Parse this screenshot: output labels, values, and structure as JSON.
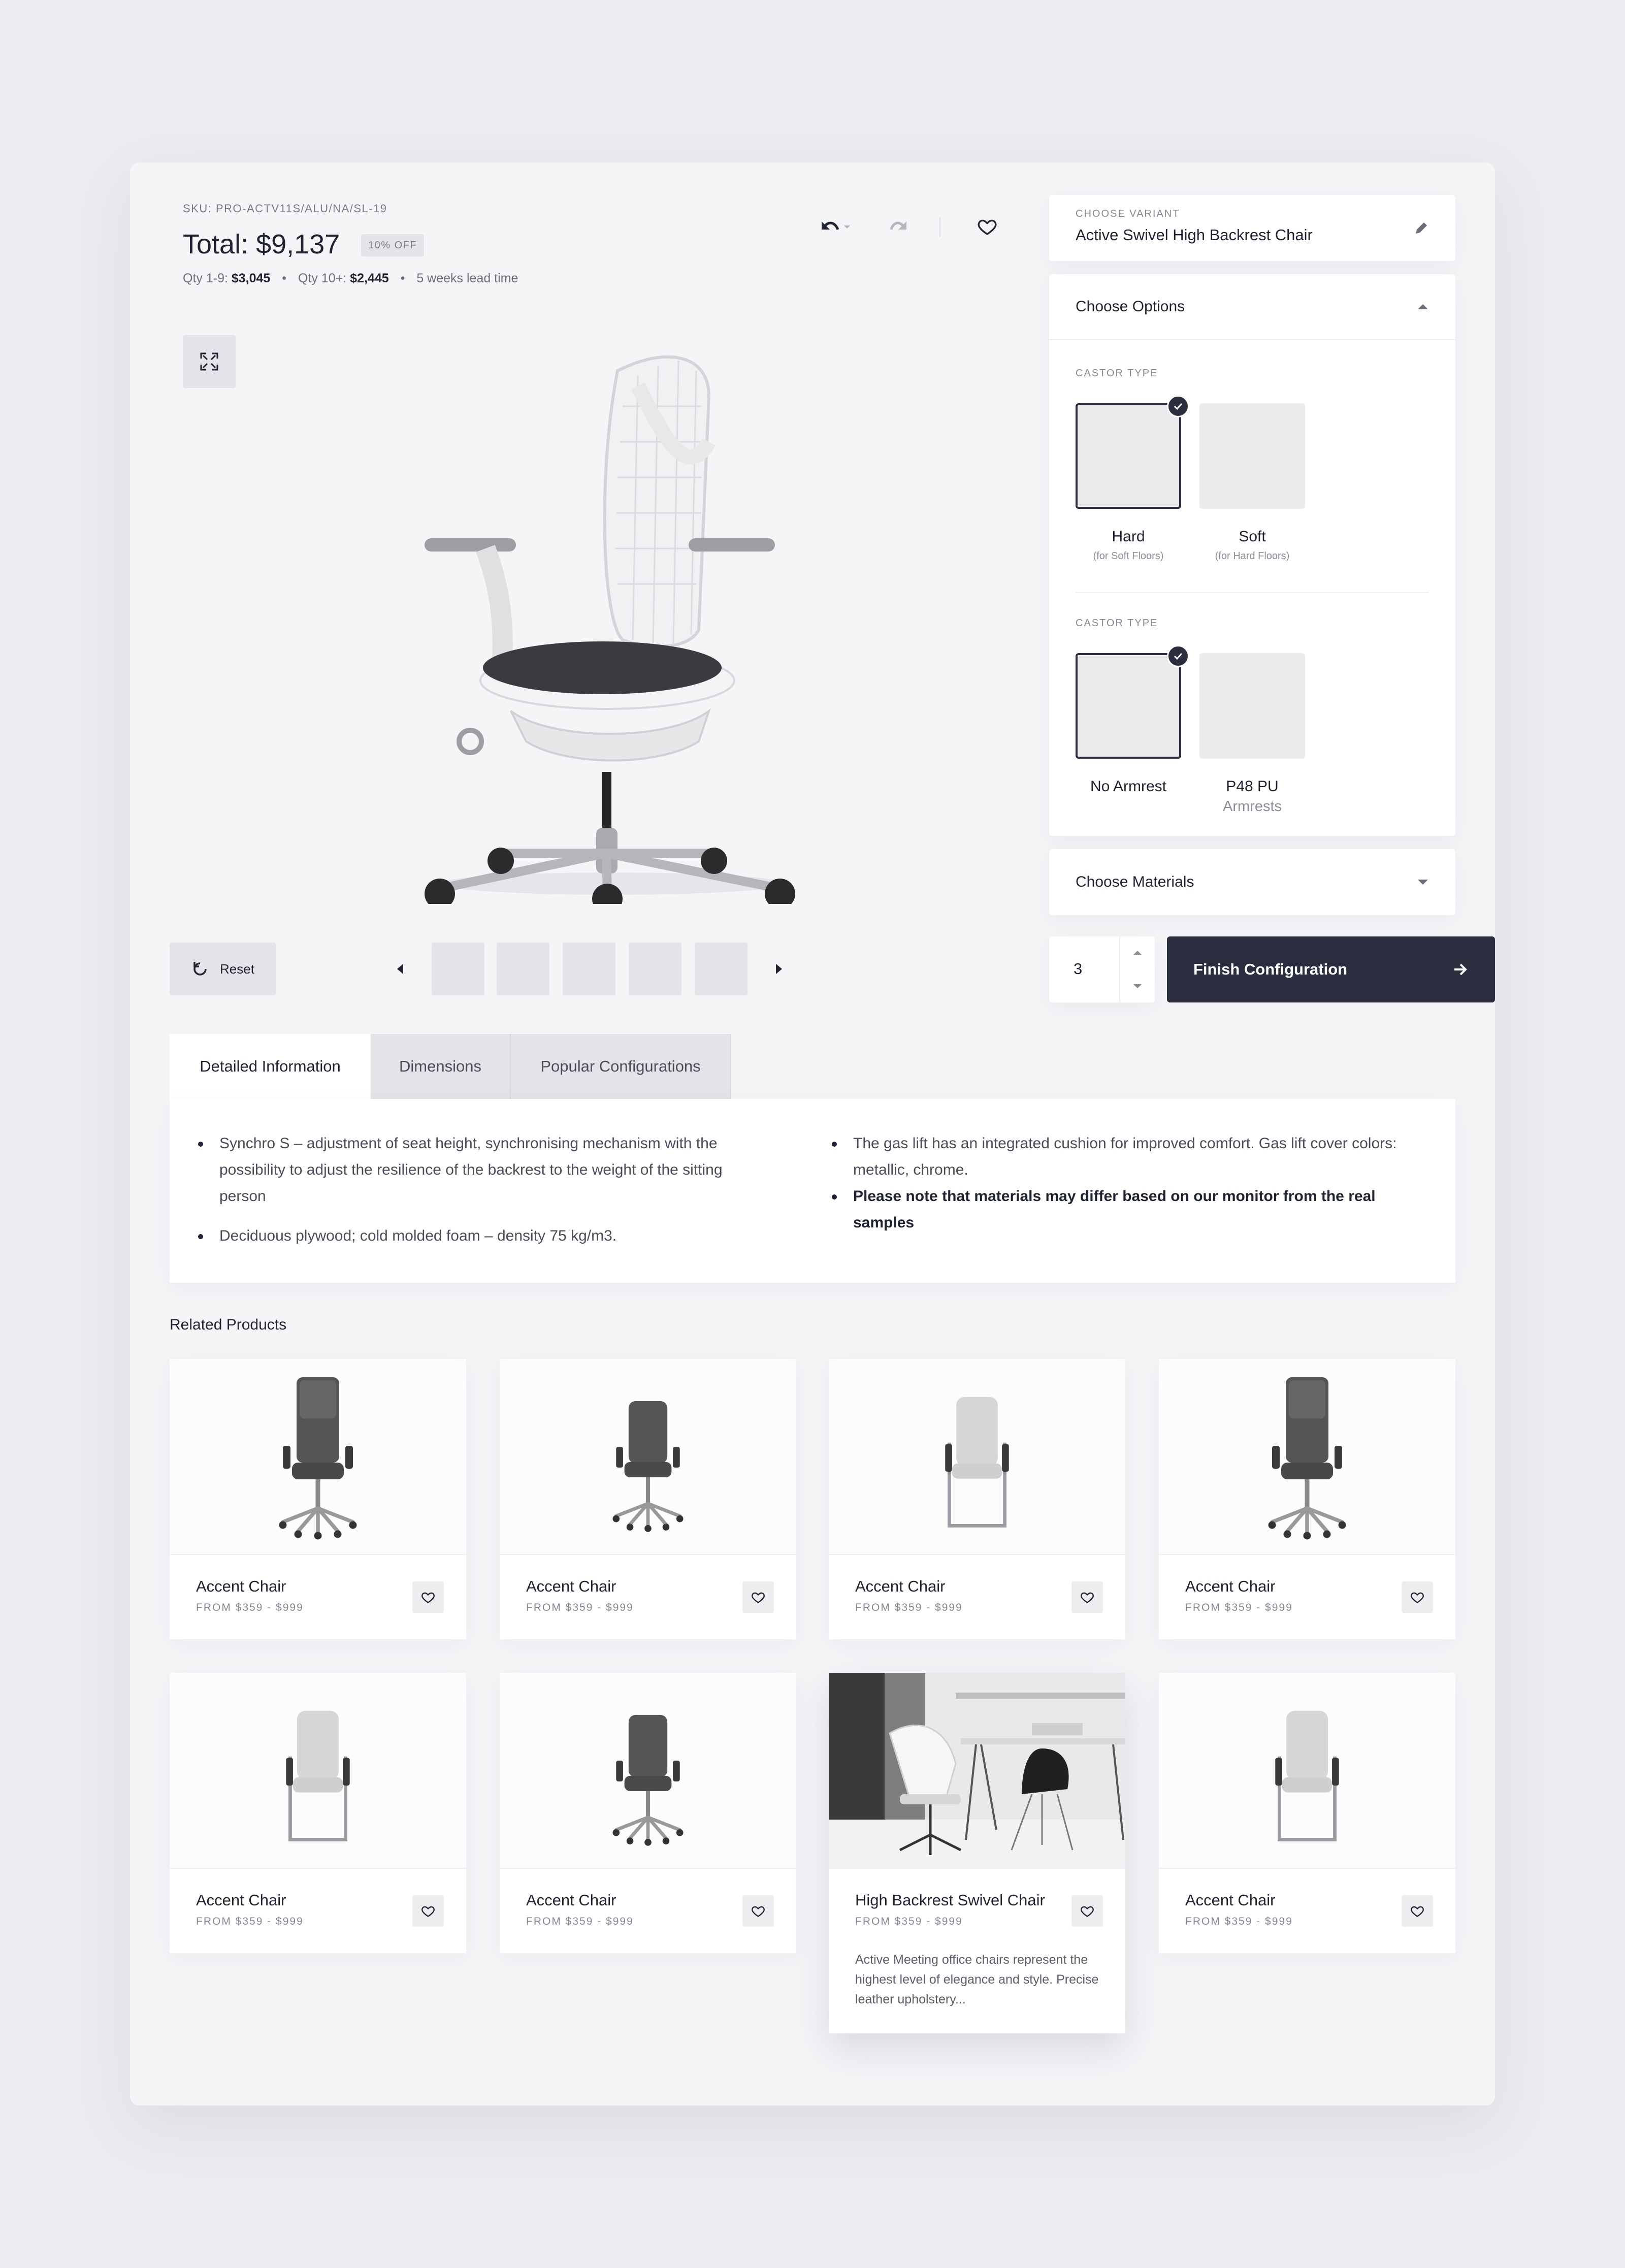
{
  "header": {
    "sku": "SKU: PRO-ACTV11S/ALU/NA/SL-19",
    "total": "Total: $9,137",
    "discount_badge": "10% OFF",
    "qty_tier1_label": "Qty 1-9:",
    "qty_tier1_price": "$3,045",
    "qty_tier2_label": "Qty 10+:",
    "qty_tier2_price": "$2,445",
    "lead_time": "5 weeks lead time"
  },
  "icons": {
    "undo": "undo-icon",
    "redo": "redo-icon",
    "favorite": "heart-icon",
    "expand": "expand-icon",
    "reset": "refresh-icon",
    "edit": "pencil-icon",
    "prev": "triangle-left-icon",
    "next": "triangle-right-icon"
  },
  "media": {
    "reset_label": "Reset"
  },
  "variant": {
    "caption": "CHOOSE VARIANT",
    "name": "Active Swivel High Backrest Chair"
  },
  "options": {
    "title": "Choose Options",
    "groups": [
      {
        "caption": "CASTOR TYPE",
        "items": [
          {
            "label": "Hard",
            "sub": "(for Soft Floors)",
            "selected": true
          },
          {
            "label": "Soft",
            "sub": "(for Hard Floors)",
            "selected": false
          }
        ]
      },
      {
        "caption": "CASTOR TYPE",
        "items": [
          {
            "label": "No Armrest",
            "sub": "",
            "selected": true
          },
          {
            "label": "P48 PU",
            "sub": "Armrests",
            "selected": false
          }
        ]
      }
    ]
  },
  "materials": {
    "title": "Choose Materials"
  },
  "quantity": {
    "value": "3"
  },
  "finish_button": "Finish Configuration",
  "tabs": [
    {
      "label": "Detailed Information",
      "active": true
    },
    {
      "label": "Dimensions",
      "active": false
    },
    {
      "label": "Popular Configurations",
      "active": false
    }
  ],
  "details": {
    "left": [
      "Synchro S – adjustment of seat height, synchronising mechanism with the possibility to adjust the resilience of the backrest to the weight of the sitting person",
      "Deciduous plywood; cold molded foam – density 75 kg/m3."
    ],
    "right": [
      "The gas lift has an integrated cushion for improved comfort. Gas lift cover colors: metallic, chrome.",
      "Please note that materials may differ based on our monitor from the real samples"
    ]
  },
  "related": {
    "title": "Related Products",
    "products": [
      {
        "name": "Accent Chair",
        "price": "FROM $359 - $999",
        "image": "dark-high-back-office-chair"
      },
      {
        "name": "Accent Chair",
        "price": "FROM $359 - $999",
        "image": "dark-mid-back-office-chair"
      },
      {
        "name": "Accent Chair",
        "price": "FROM $359 - $999",
        "image": "light-cantilever-chair"
      },
      {
        "name": "Accent Chair",
        "price": "FROM $359 - $999",
        "image": "dark-high-back-office-chair"
      },
      {
        "name": "Accent Chair",
        "price": "FROM $359 - $999",
        "image": "light-cantilever-chair"
      },
      {
        "name": "Accent Chair",
        "price": "FROM $359 - $999",
        "image": "dark-mid-back-office-chair"
      },
      {
        "name": "High Backrest Swivel Chair",
        "price": "FROM $359 - $999",
        "image": "office-room-photo",
        "description": "Active Meeting office chairs represent the highest level of elegance and style. Precise leather upholstery..."
      },
      {
        "name": "Accent Chair",
        "price": "FROM $359 - $999",
        "image": "light-cantilever-chair"
      }
    ]
  },
  "colors": {
    "background": "#ececf0",
    "panel": "#f5f5f8",
    "accent_dark": "#2a2e3e",
    "muted": "#858894",
    "swatch": "#ebebee"
  }
}
